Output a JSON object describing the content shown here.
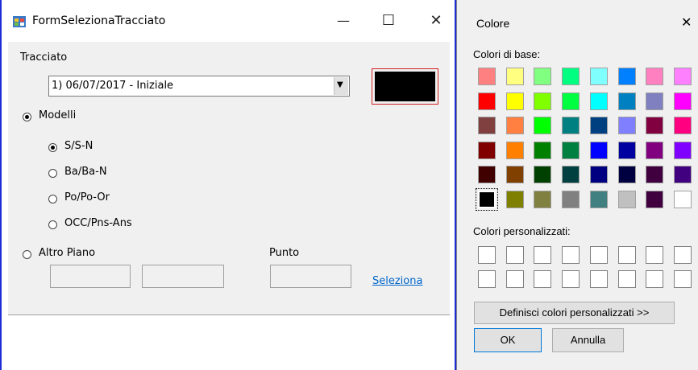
{
  "form": {
    "title": "FormSelezionaTracciato",
    "minimize": "—",
    "maximize": "☐",
    "close": "✕",
    "tracciato_label": "Tracciato",
    "tracciato_value": "1) 06/07/2017 - Iniziale",
    "dropdown_arrow": "▼",
    "modelli_label": "Modelli",
    "models": [
      "S/S-N",
      "Ba/Ba-N",
      "Po/Po-Or",
      "OCC/Pns-Ans"
    ],
    "altro_label": "Altro Piano",
    "punto_label": "Punto",
    "seleziona_link": "Seleziona",
    "selected_color": "#000000"
  },
  "dialog": {
    "title": "Colore",
    "close": "✕",
    "basic_label": "Colori di base:",
    "custom_label": "Colori personalizzati:",
    "define_button": "Definisci colori personalizzati >>",
    "ok_button": "OK",
    "cancel_button": "Annulla",
    "basic_colors": [
      [
        "#ff8080",
        "#ffff80",
        "#80ff80",
        "#00ff80",
        "#80ffff",
        "#0080ff",
        "#ff80c0",
        "#ff80ff"
      ],
      [
        "#ff0000",
        "#ffff00",
        "#80ff00",
        "#00ff40",
        "#00ffff",
        "#0080c0",
        "#8080c0",
        "#ff00ff"
      ],
      [
        "#804040",
        "#ff8040",
        "#00ff00",
        "#008080",
        "#004080",
        "#8080ff",
        "#800040",
        "#ff0080"
      ],
      [
        "#800000",
        "#ff8000",
        "#008000",
        "#008040",
        "#0000ff",
        "#0000a0",
        "#800080",
        "#8000ff"
      ],
      [
        "#400000",
        "#804000",
        "#004000",
        "#004040",
        "#000080",
        "#000040",
        "#400040",
        "#400080"
      ],
      [
        "#000000",
        "#808000",
        "#808040",
        "#808080",
        "#408080",
        "#c0c0c0",
        "#400040",
        "#ffffff"
      ]
    ],
    "selected_index": 40
  }
}
